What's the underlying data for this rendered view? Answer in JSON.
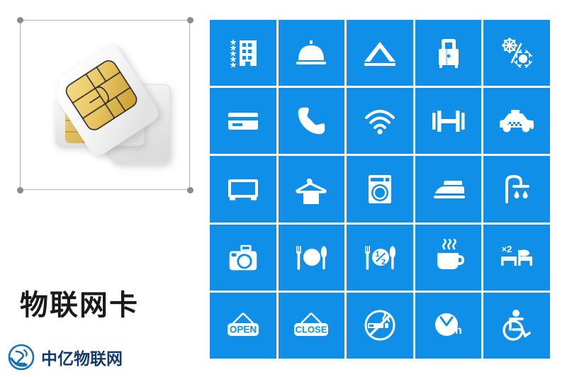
{
  "page": {
    "background_color": "#ffffff",
    "accent_color": "#0f8fe8",
    "icon_color": "#ffffff"
  },
  "left_panel": {
    "product_title": "物联网卡",
    "image": {
      "name": "sim-card-photo",
      "description": "Two white SIM cards with golden contact chips, upper one rotated",
      "selected": true,
      "handle_color": "#8c8c8c",
      "frame_color": "#b4b4b4"
    },
    "watermark": {
      "logo_name": "zhongyi-circular-logo",
      "text": "中亿物联网",
      "logo_color": "#1a6fb5",
      "text_color": "#123a6b"
    }
  },
  "icon_grid": {
    "columns": 5,
    "rows": 5,
    "tile_color": "#0f8fe8",
    "gap_color": "#ffffff",
    "icons": [
      {
        "id": "hotel-stars",
        "name": "hotel-star-rating-icon",
        "label": "Star-rated hotel"
      },
      {
        "id": "room-service",
        "name": "room-service-bell-icon",
        "label": "Room service"
      },
      {
        "id": "camping-tent",
        "name": "camping-tent-icon",
        "label": "Camping / tent"
      },
      {
        "id": "luggage",
        "name": "luggage-suitcase-icon",
        "label": "Luggage storage"
      },
      {
        "id": "air-conditioning",
        "name": "air-conditioning-icon",
        "label": "Air conditioning"
      },
      {
        "id": "credit-card",
        "name": "credit-card-icon",
        "label": "Card payment"
      },
      {
        "id": "telephone",
        "name": "telephone-handset-icon",
        "label": "Telephone"
      },
      {
        "id": "wifi",
        "name": "wifi-icon",
        "label": "Wi-Fi"
      },
      {
        "id": "gym",
        "name": "dumbbell-gym-icon",
        "label": "Gym / fitness"
      },
      {
        "id": "taxi",
        "name": "taxi-car-icon",
        "label": "Taxi service"
      },
      {
        "id": "television",
        "name": "television-icon",
        "label": "Television"
      },
      {
        "id": "clothes-hanger",
        "name": "clothes-hanger-icon",
        "label": "Wardrobe / laundry"
      },
      {
        "id": "washing-machine",
        "name": "washing-machine-icon",
        "label": "Washing machine"
      },
      {
        "id": "iron",
        "name": "clothes-iron-icon",
        "label": "Ironing"
      },
      {
        "id": "shower",
        "name": "shower-icon",
        "label": "Shower"
      },
      {
        "id": "camera",
        "name": "photo-camera-icon",
        "label": "Camera / photos"
      },
      {
        "id": "restaurant",
        "name": "restaurant-cutlery-icon",
        "label": "Restaurant"
      },
      {
        "id": "half-board",
        "name": "half-board-icon",
        "label": "Half board",
        "text": "1/2"
      },
      {
        "id": "coffee",
        "name": "coffee-cup-icon",
        "label": "Coffee / breakfast"
      },
      {
        "id": "double-bed",
        "name": "double-bed-icon",
        "label": "Double occupancy",
        "text": "x2"
      },
      {
        "id": "open-sign",
        "name": "open-sign-icon",
        "label": "Open",
        "text": "OPEN"
      },
      {
        "id": "close-sign",
        "name": "close-sign-icon",
        "label": "Closed",
        "text": "CLOSE"
      },
      {
        "id": "no-smoking",
        "name": "no-smoking-icon",
        "label": "No smoking"
      },
      {
        "id": "twenty-four-hour",
        "name": "24-hour-clock-icon",
        "label": "24 hour service",
        "text": "24h"
      },
      {
        "id": "wheelchair",
        "name": "wheelchair-accessible-icon",
        "label": "Wheelchair accessible"
      }
    ]
  }
}
